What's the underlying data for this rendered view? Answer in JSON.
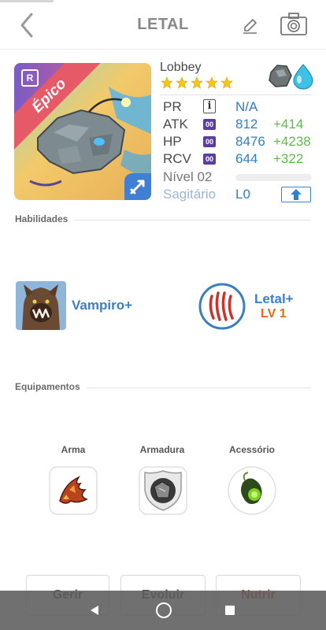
{
  "header": {
    "title": "LETAL"
  },
  "card": {
    "rarity": "Épico",
    "grade_badge": "R",
    "name": "Lobbey",
    "star_count": 5,
    "element_icons": [
      "rock-icon",
      "water-drop-icon"
    ],
    "stats": {
      "pr": {
        "label": "PR",
        "badge": "i",
        "value": "N/A"
      },
      "atk": {
        "label": "ATK",
        "badge": "00",
        "value": "812",
        "bonus": "+414"
      },
      "hp": {
        "label": "HP",
        "badge": "00",
        "value": "8476",
        "bonus": "+4238"
      },
      "rcv": {
        "label": "RCV",
        "badge": "00",
        "value": "644",
        "bonus": "+322"
      }
    },
    "level_label": "Nível 02",
    "class_label": "Sagitário",
    "class_level": "L0"
  },
  "sections": {
    "skills": "Habilidades",
    "equipment": "Equipamentos"
  },
  "skills": [
    {
      "name": "Vampiro+"
    },
    {
      "name": "Letal+",
      "level": "LV 1"
    }
  ],
  "equipment": [
    {
      "label": "Arma"
    },
    {
      "label": "Armadura"
    },
    {
      "label": "Acessório"
    }
  ],
  "actions": {
    "manage": "Gerir",
    "evolve": "Evoluir",
    "feed": "Nutrir"
  },
  "colors": {
    "accent_blue": "#2f7dc4",
    "bonus_green": "#5bbd46",
    "rarity_red": "#e65a68",
    "star_yellow": "#f5c518",
    "level_orange": "#e06a18",
    "feed_red": "#c9421f"
  }
}
